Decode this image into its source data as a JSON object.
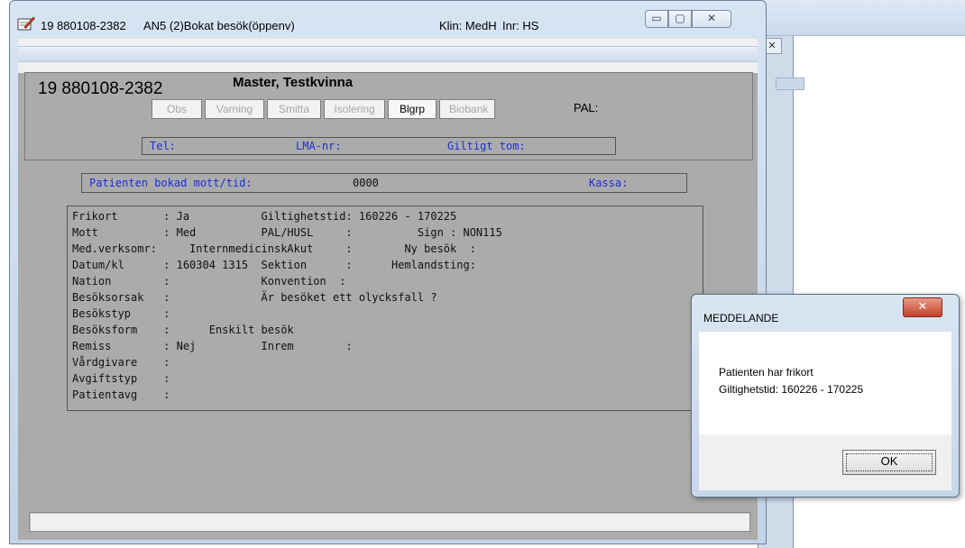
{
  "window": {
    "personnummer": "19 880108-2382",
    "title": "AN5 (2)Bokat besök(öppenv)",
    "clinic": "Klin: MedH",
    "inr": "Inr: HS",
    "minimize_icon": "▭",
    "maximize_icon": "▢",
    "close_icon": "✕"
  },
  "background_window": {
    "close_icon": "✕"
  },
  "patient": {
    "personnummer": "19 880108-2382",
    "name": "Master, Testkvinna",
    "flags": [
      {
        "label": "Obs",
        "active": false
      },
      {
        "label": "Varning",
        "active": false
      },
      {
        "label": "Smitta",
        "active": false
      },
      {
        "label": "Isolering",
        "active": false
      },
      {
        "label": "Blgrp",
        "active": true
      },
      {
        "label": "Biobank",
        "active": false
      }
    ],
    "pal_label": "PAL:"
  },
  "contact": {
    "tel_label": "Tel:",
    "lma_label": "LMA-nr:",
    "valid_label": "Giltigt tom:"
  },
  "booking": {
    "label": "Patienten bokad mott/tid:",
    "value": "0000",
    "kassa_label": "Kassa:"
  },
  "details": {
    "rows": [
      "Frikort       : Ja           Giltighetstid: 160226 - 170225",
      "Mott          : Med          PAL/HUSL     :          Sign : NON115",
      "Med.verksomr:     InternmedicinskAkut     :        Ny besök  :",
      "Datum/kl      : 160304 1315  Sektion      :      Hemlandsting:",
      "Nation        :              Konvention  :",
      "Besöksorsak   :              Är besöket ett olycksfall ?",
      "Besökstyp     :",
      "Besöksform    :      Enskilt besök",
      "Remiss        : Nej          Inrem        :",
      "Vårdgivare    :",
      "Avgiftstyp    :",
      "Patientavg    :"
    ]
  },
  "dialog": {
    "title": "MEDDELANDE",
    "close_icon": "✕",
    "message_line1": "Patienten har frikort",
    "message_line2": "Giltighetstid: 160226 - 170225",
    "ok_label": "OK"
  }
}
